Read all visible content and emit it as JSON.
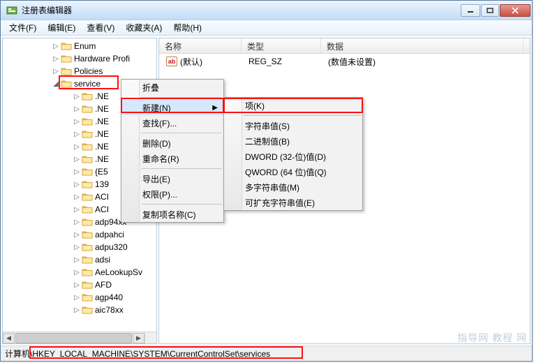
{
  "window": {
    "title": "注册表编辑器"
  },
  "menu": {
    "file": "文件(F)",
    "edit": "编辑(E)",
    "view": "查看(V)",
    "favorites": "收藏夹(A)",
    "help": "帮助(H)"
  },
  "tree": {
    "items": [
      {
        "indent": 70,
        "exp": "▷",
        "label": "Enum"
      },
      {
        "indent": 70,
        "exp": "▷",
        "label": "Hardware Profi"
      },
      {
        "indent": 70,
        "exp": "▷",
        "label": "Policies"
      },
      {
        "indent": 70,
        "exp": "◢",
        "label": "service"
      },
      {
        "indent": 100,
        "exp": "▷",
        "label": ".NE"
      },
      {
        "indent": 100,
        "exp": "▷",
        "label": ".NE"
      },
      {
        "indent": 100,
        "exp": "▷",
        "label": ".NE"
      },
      {
        "indent": 100,
        "exp": "▷",
        "label": ".NE"
      },
      {
        "indent": 100,
        "exp": "▷",
        "label": ".NE"
      },
      {
        "indent": 100,
        "exp": "▷",
        "label": ".NE"
      },
      {
        "indent": 100,
        "exp": "▷",
        "label": "{E5"
      },
      {
        "indent": 100,
        "exp": "▷",
        "label": "139"
      },
      {
        "indent": 100,
        "exp": "▷",
        "label": "ACI"
      },
      {
        "indent": 100,
        "exp": "▷",
        "label": "ACI"
      },
      {
        "indent": 100,
        "exp": "▷",
        "label": "adp94xx"
      },
      {
        "indent": 100,
        "exp": "▷",
        "label": "adpahci"
      },
      {
        "indent": 100,
        "exp": "▷",
        "label": "adpu320"
      },
      {
        "indent": 100,
        "exp": "▷",
        "label": "adsi"
      },
      {
        "indent": 100,
        "exp": "▷",
        "label": "AeLookupSv"
      },
      {
        "indent": 100,
        "exp": "▷",
        "label": "AFD"
      },
      {
        "indent": 100,
        "exp": "▷",
        "label": "agp440"
      },
      {
        "indent": 100,
        "exp": "▷",
        "label": "aic78xx"
      }
    ]
  },
  "list": {
    "headers": {
      "name": "名称",
      "type": "类型",
      "data": "数据"
    },
    "col_widths": {
      "name": 118,
      "type": 114,
      "data": 290
    },
    "rows": [
      {
        "icon": "ab",
        "name": "(默认)",
        "type": "REG_SZ",
        "data": "(数值未设置)"
      }
    ]
  },
  "context_menu": {
    "collapse": "折叠",
    "new": "新建(N)",
    "find": "查找(F)...",
    "delete": "删除(D)",
    "rename": "重命名(R)",
    "export": "导出(E)",
    "permissions": "权限(P)...",
    "copy_key_name": "复制项名称(C)"
  },
  "submenu": {
    "key": "项(K)",
    "string": "字符串值(S)",
    "binary": "二进制值(B)",
    "dword": "DWORD (32-位)值(D)",
    "qword": "QWORD (64 位)值(Q)",
    "multi_string": "多字符串值(M)",
    "expand_string": "可扩充字符串值(E)"
  },
  "statusbar": {
    "label": "计算机",
    "path": "\\HKEY_LOCAL_MACHINE\\SYSTEM\\CurrentControlSet\\services"
  },
  "watermark": "指导网 教程 网",
  "colors": {
    "highlight_red": "#ff1010"
  }
}
